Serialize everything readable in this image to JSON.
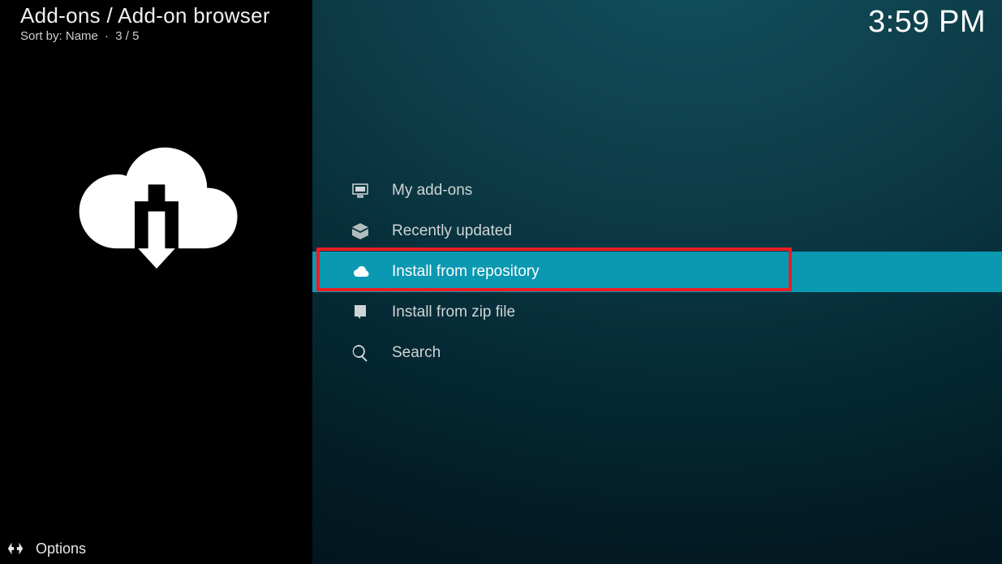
{
  "header": {
    "breadcrumb": "Add-ons / Add-on browser",
    "sort_prefix": "Sort by:",
    "sort_value": "Name",
    "position": "3 / 5"
  },
  "clock": "3:59 PM",
  "menu": {
    "items": [
      {
        "label": "My add-ons",
        "icon": "monitor-icon",
        "selected": false
      },
      {
        "label": "Recently updated",
        "icon": "box-icon",
        "selected": false
      },
      {
        "label": "Install from repository",
        "icon": "cloud-install-icon",
        "selected": true
      },
      {
        "label": "Install from zip file",
        "icon": "zip-install-icon",
        "selected": false
      },
      {
        "label": "Search",
        "icon": "search-icon",
        "selected": false
      }
    ]
  },
  "footer": {
    "options_label": "Options"
  }
}
